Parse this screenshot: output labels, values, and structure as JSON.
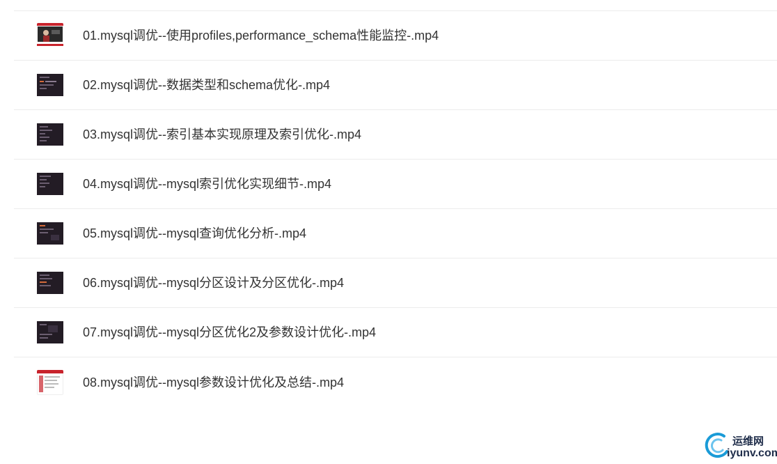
{
  "files": [
    {
      "name": "01.mysql调优--使用profiles,performance_schema性能监控-.mp4",
      "thumb": "video-thumb-red"
    },
    {
      "name": "02.mysql调优--数据类型和schema优化-.mp4",
      "thumb": "video-thumb-dark"
    },
    {
      "name": "03.mysql调优--索引基本实现原理及索引优化-.mp4",
      "thumb": "video-thumb-dark"
    },
    {
      "name": "04.mysql调优--mysql索引优化实现细节-.mp4",
      "thumb": "video-thumb-dark"
    },
    {
      "name": "05.mysql调优--mysql查询优化分析-.mp4",
      "thumb": "video-thumb-dark"
    },
    {
      "name": "06.mysql调优--mysql分区设计及分区优化-.mp4",
      "thumb": "video-thumb-dark"
    },
    {
      "name": "07.mysql调优--mysql分区优化2及参数设计优化-.mp4",
      "thumb": "video-thumb-dark"
    },
    {
      "name": "08.mysql调优--mysql参数设计优化及总结-.mp4",
      "thumb": "video-thumb-light"
    }
  ],
  "watermark": {
    "site_name": "运维网",
    "url": "iyunv.com"
  },
  "colors": {
    "text": "#333333",
    "divider": "#ececec",
    "thumb_dark": "#231c25",
    "thumb_red": "#c8232c",
    "watermark": "#1f2d4a"
  }
}
